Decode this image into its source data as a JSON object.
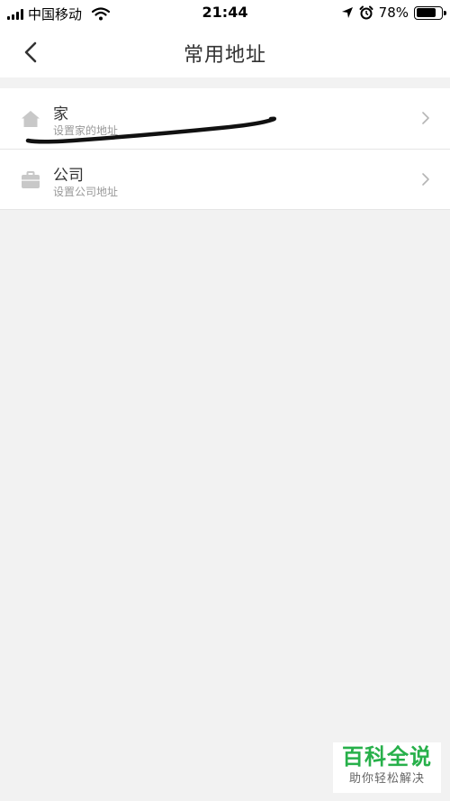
{
  "status_bar": {
    "carrier": "中国移动",
    "time": "21:44",
    "battery_percent": "78%",
    "battery_level": 0.78,
    "icons": [
      "signal-icon",
      "wifi-icon",
      "location-arrow-icon",
      "alarm-icon",
      "battery-icon"
    ]
  },
  "nav": {
    "title": "常用地址",
    "back_icon": "chevron-left-icon"
  },
  "addresses": [
    {
      "title": "家",
      "subtitle": "设置家的地址",
      "icon": "home-icon"
    },
    {
      "title": "公司",
      "subtitle": "设置公司地址",
      "icon": "briefcase-icon"
    }
  ],
  "watermark": {
    "title": "百科全说",
    "subtitle": "助你轻松解决"
  },
  "colors": {
    "background": "#f2f2f2",
    "surface": "#ffffff",
    "icon_gray": "#c8c8c8",
    "subtitle": "#999999",
    "watermark_green": "#27b04a"
  }
}
